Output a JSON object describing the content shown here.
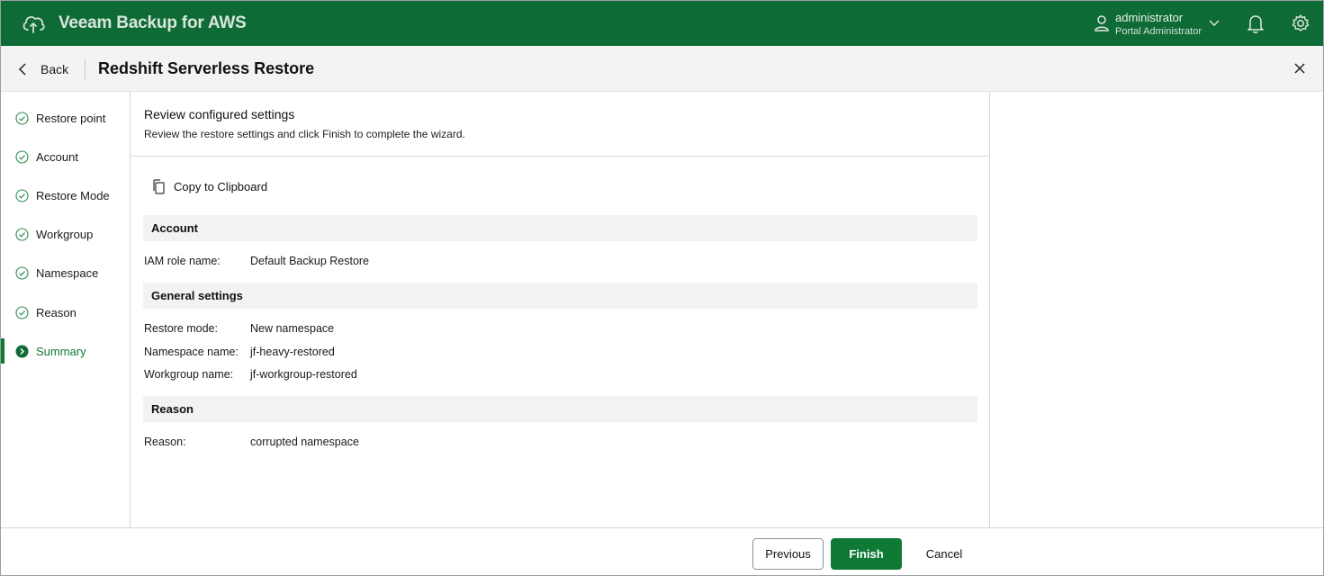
{
  "app": {
    "title": "Veeam Backup for AWS",
    "brand_color": "#0f6b35",
    "accent_color": "#0f7a36"
  },
  "topbar": {
    "user_name": "administrator",
    "user_role": "Portal Administrator",
    "icons": [
      "cloud-logo-icon",
      "user-icon",
      "chevron-down-icon",
      "bell-icon",
      "gear-icon"
    ]
  },
  "header": {
    "back_label": "Back",
    "title": "Redshift Serverless Restore"
  },
  "steps": [
    {
      "label": "Restore point",
      "state": "done"
    },
    {
      "label": "Account",
      "state": "done"
    },
    {
      "label": "Restore Mode",
      "state": "done"
    },
    {
      "label": "Workgroup",
      "state": "done"
    },
    {
      "label": "Namespace",
      "state": "done"
    },
    {
      "label": "Reason",
      "state": "done"
    },
    {
      "label": "Summary",
      "state": "active"
    }
  ],
  "main": {
    "title": "Review configured settings",
    "description": "Review the restore settings and click Finish to complete the wizard.",
    "copy_label": "Copy to Clipboard",
    "sections": [
      {
        "title": "Account",
        "rows": [
          {
            "key": "IAM role name:",
            "value": "Default Backup Restore"
          }
        ]
      },
      {
        "title": "General settings",
        "rows": [
          {
            "key": "Restore mode:",
            "value": "New namespace"
          },
          {
            "key": "Namespace name:",
            "value": "jf-heavy-restored"
          },
          {
            "key": "Workgroup name:",
            "value": "jf-workgroup-restored"
          }
        ]
      },
      {
        "title": "Reason",
        "rows": [
          {
            "key": "Reason:",
            "value": "corrupted namespace"
          }
        ]
      }
    ]
  },
  "footer": {
    "previous_label": "Previous",
    "finish_label": "Finish",
    "cancel_label": "Cancel"
  }
}
